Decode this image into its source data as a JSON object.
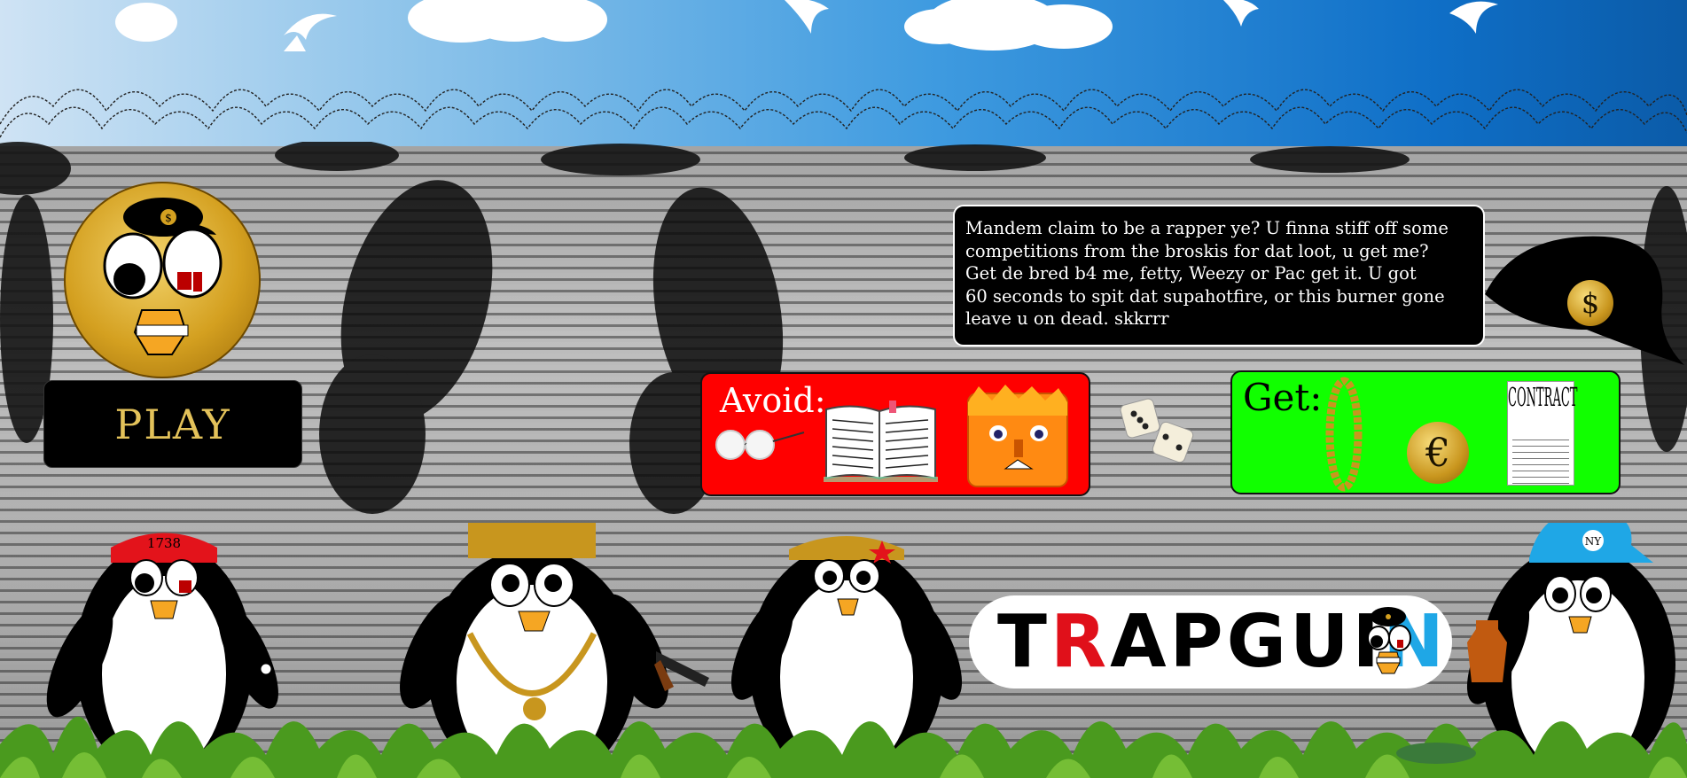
{
  "game": {
    "title_prefix": "T",
    "title_r": "R",
    "title_mid": "APGUI",
    "title_n": "N",
    "play_label": "PLAY",
    "speech_lines": [
      "Mandem claim to be a rapper ye? U finna stiff off some",
      "competitions from the broskis for dat loot, u get me?",
      "Get de bred b4 me, fetty, Weezy or Pac get it. U got",
      "60 seconds to spit dat supahotfire, or this burner gone",
      "leave u on dead. skkrrr"
    ],
    "avoid_label": "Avoid:",
    "get_label": "Get:",
    "euro_symbol": "€",
    "dollar_symbol": "$",
    "contract_title": "CONTRACT",
    "headband_number": "1738",
    "cap_text": "NY"
  },
  "colors": {
    "avoid_bg": "#ff0000",
    "get_bg": "#11ff00",
    "gold": "#d4a020",
    "logo_red": "#e0101a",
    "logo_blue": "#1fa7e6"
  },
  "icons": {
    "avoid_items": [
      "glasses-icon",
      "book-icon",
      "angry-face-icon"
    ],
    "get_items": [
      "gold-chain-icon",
      "euro-coin-icon",
      "contract-icon"
    ],
    "decor": [
      "dice-icon",
      "seagull-icon",
      "cloud-icon",
      "barbed-wire-icon"
    ]
  }
}
